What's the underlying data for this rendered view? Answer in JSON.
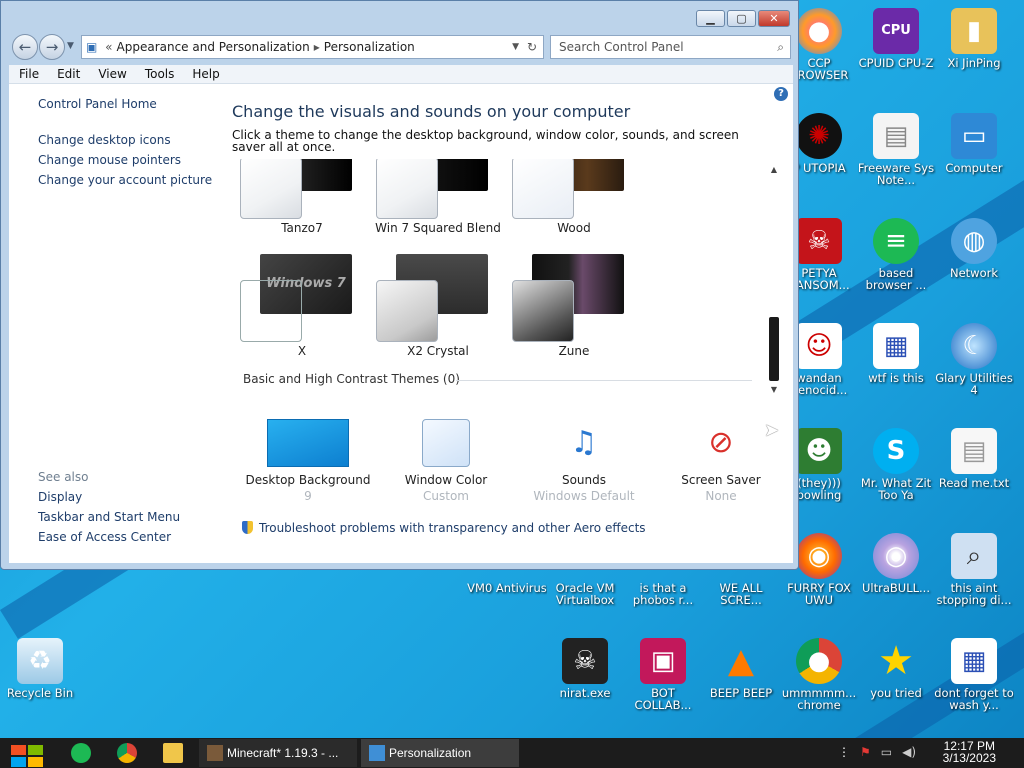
{
  "window": {
    "breadcrumb": [
      "Appearance and Personalization",
      "Personalization"
    ],
    "search_placeholder": "Search Control Panel",
    "menu": [
      "File",
      "Edit",
      "View",
      "Tools",
      "Help"
    ]
  },
  "leftnav": {
    "home": "Control Panel Home",
    "links": [
      "Change desktop icons",
      "Change mouse pointers",
      "Change your account picture"
    ],
    "see_also_heading": "See also",
    "see_also": [
      "Display",
      "Taskbar and Start Menu",
      "Ease of Access Center"
    ]
  },
  "main": {
    "title": "Change the visuals and sounds on your computer",
    "subtitle": "Click a theme to change the desktop background, window color, sounds, and screen saver all at once.",
    "themes_row1": [
      "Tanzo7",
      "Win 7 Squared Blend",
      "Wood"
    ],
    "themes_row2": [
      "X",
      "X2 Crystal",
      "Zune"
    ],
    "theme_overlay_text": "Windows 7",
    "basic_section": "Basic and High Contrast Themes (0)",
    "options": [
      {
        "label": "Desktop Background",
        "value": "9"
      },
      {
        "label": "Window Color",
        "value": "Custom"
      },
      {
        "label": "Sounds",
        "value": "Windows Default"
      },
      {
        "label": "Screen Saver",
        "value": "None"
      }
    ],
    "troubleshoot": "Troubleshoot problems with transparency and other Aero effects"
  },
  "desktop_icons": {
    "ccp": "CCP BROWSER",
    "cpuz": "CPUID CPU-Z",
    "xi": "Xi JinPing",
    "utopia": "P UTOPIA",
    "freeware": "Freeware Sys Note...",
    "computer": "Computer",
    "petya": "PETYA RANSOM...",
    "based": "based browser ...",
    "network": "Network",
    "wandan": "wandan genocid...",
    "wtf": "wtf is this",
    "glary": "Glary Utilities 4",
    "bowling": "(they))) bowling",
    "whatzit": "Mr. What Zit Too Ya",
    "readme": "Read me.txt",
    "vm0": "VM0 Antivirus",
    "oracle": "Oracle VM Virtualbox",
    "phobos": "is that a phobos r...",
    "weall": "WE ALL SCRE...",
    "furry": "FURRY FOX UWU",
    "ultrabull": "UltraBULL...",
    "thisaint": "this aint stopping di...",
    "recycle": "Recycle Bin",
    "nirat": "nirat.exe",
    "bot": "BOT COLLAB...",
    "beep": "BEEP BEEP",
    "chrome": "ummmmm... chrome",
    "youtried": "you tried",
    "dontforget": "dont forget to wash y..."
  },
  "taskbar": {
    "tasks": [
      "Minecraft* 1.19.3 - ...",
      "Personalization"
    ],
    "time": "12:17 PM",
    "date": "3/13/2023"
  }
}
